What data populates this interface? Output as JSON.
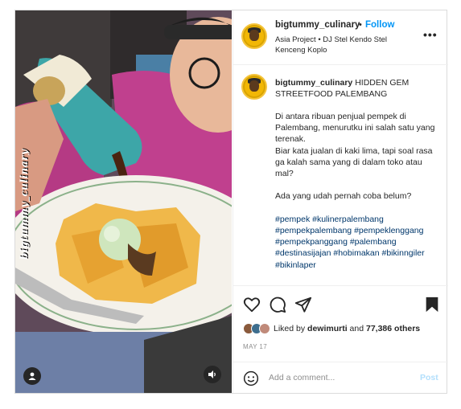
{
  "post": {
    "username": "bigtummy_culinary",
    "follow_label": "Follow",
    "separator": "•",
    "audio": "Asia Project • DJ Stel Kendo Stel Kenceng Koplo",
    "more_label": "•••",
    "watermark": "bigtummy_culinary"
  },
  "caption": {
    "username": "bigtummy_culinary",
    "title": "HIDDEN GEM STREETFOOD PALEMBANG",
    "lines": [
      "Di antara ribuan penjual pempek di Palembang, menurutku ini salah satu yang terenak.",
      "Biar kata jualan di kaki lima, tapi soal rasa ga kalah sama yang di dalam toko atau mal?",
      "Ada yang udah pernah coba belum?"
    ],
    "hashtags": "#pempek #kulinerpalembang #pempekpalembang #pempeklenggang #pempekpanggang #palembang #destinasijajan #hobimakan #bikinngiler #bikinlaper"
  },
  "engagement": {
    "liked_by_prefix": "Liked by",
    "liked_by_user": "dewimurti",
    "and": "and",
    "others": "77,386 others",
    "date": "MAY 17"
  },
  "comment": {
    "placeholder": "Add a comment...",
    "post_label": "Post"
  },
  "colors": {
    "accent": "#0095f6",
    "post_disabled": "#b2dffc",
    "avatar_ring": "#f5c43b"
  }
}
